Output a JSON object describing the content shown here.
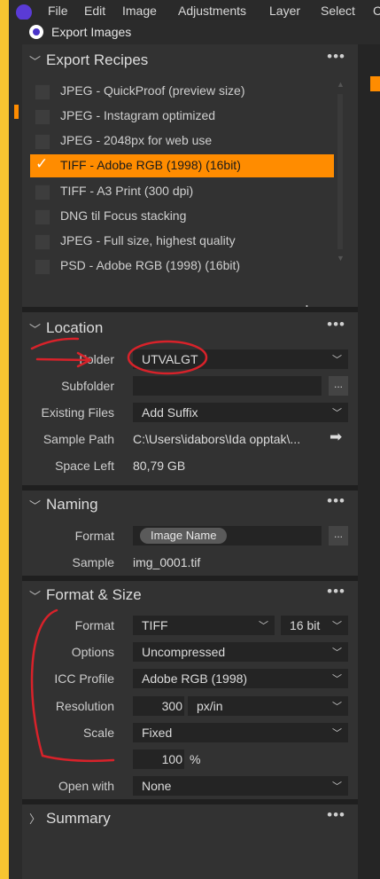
{
  "menubar": {
    "items": [
      "File",
      "Edit",
      "Image",
      "Adjustments",
      "Layer",
      "Select",
      "C"
    ]
  },
  "window": {
    "title": "Export Images"
  },
  "recipes": {
    "title": "Export Recipes",
    "items": [
      {
        "label": "JPEG - QuickProof (preview size)",
        "checked": false
      },
      {
        "label": "JPEG - Instagram optimized",
        "checked": false
      },
      {
        "label": "JPEG - 2048px for web use",
        "checked": false
      },
      {
        "label": "TIFF - Adobe RGB (1998) (16bit)",
        "checked": true
      },
      {
        "label": "TIFF - A3 Print (300 dpi)",
        "checked": false
      },
      {
        "label": "DNG til Focus stacking",
        "checked": false
      },
      {
        "label": "JPEG - Full size, highest quality",
        "checked": false
      },
      {
        "label": "PSD - Adobe RGB (1998) (16bit)",
        "checked": false
      }
    ],
    "add_symbol": "+",
    "remove_symbol": "−"
  },
  "location": {
    "title": "Location",
    "folder_label": "Folder",
    "folder_value": "UTVALGT",
    "subfolder_label": "Subfolder",
    "subfolder_value": "",
    "existing_label": "Existing Files",
    "existing_value": "Add Suffix",
    "sample_path_label": "Sample Path",
    "sample_path_value": "C:\\Users\\idabors\\Ida opptak\\...",
    "space_left_label": "Space Left",
    "space_left_value": "80,79 GB"
  },
  "naming": {
    "title": "Naming",
    "format_label": "Format",
    "format_token": "Image Name",
    "sample_label": "Sample",
    "sample_value": "img_0001.tif"
  },
  "format_size": {
    "title": "Format & Size",
    "format_label": "Format",
    "format_value": "TIFF",
    "bit_value": "16 bit",
    "options_label": "Options",
    "options_value": "Uncompressed",
    "icc_label": "ICC Profile",
    "icc_value": "Adobe RGB (1998)",
    "resolution_label": "Resolution",
    "resolution_value": "300",
    "resolution_unit": "px/in",
    "scale_label": "Scale",
    "scale_value": "Fixed",
    "scale_percent": "100",
    "percent_sign": "%",
    "open_with_label": "Open with",
    "open_with_value": "None"
  },
  "summary": {
    "title": "Summary"
  },
  "common": {
    "more": "•••",
    "ellipsis": "..."
  },
  "colors": {
    "accent": "#ff8c00",
    "annotation": "#d8222a",
    "panel": "#323232",
    "field": "#242424"
  }
}
